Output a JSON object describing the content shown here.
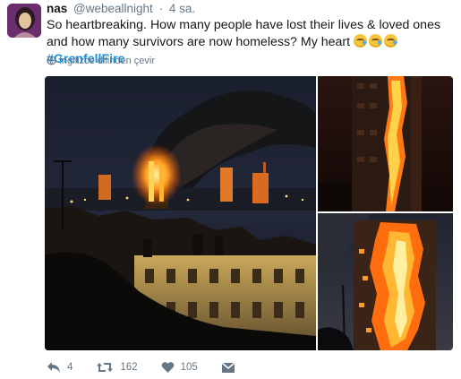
{
  "tweet": {
    "name": "nas",
    "handle": "@webeallnight",
    "separator": "·",
    "time": "4 sa.",
    "text": "So heartbreaking. How many people have lost their lives & loved ones and how many survivors are now homeless? My heart",
    "hashtag": "#GrenfellFire",
    "translate_label": "İngilizce dilinden çevir"
  },
  "actions": {
    "reply_count": "4",
    "retweet_count": "162",
    "like_count": "105"
  },
  "icons": [
    "avatar",
    "emoji-sad-icon",
    "globe-icon",
    "reply-icon",
    "retweet-icon",
    "heart-icon",
    "message-icon"
  ],
  "colors": {
    "link": "#1b95e0",
    "meta": "#657786",
    "text": "#14171a"
  }
}
